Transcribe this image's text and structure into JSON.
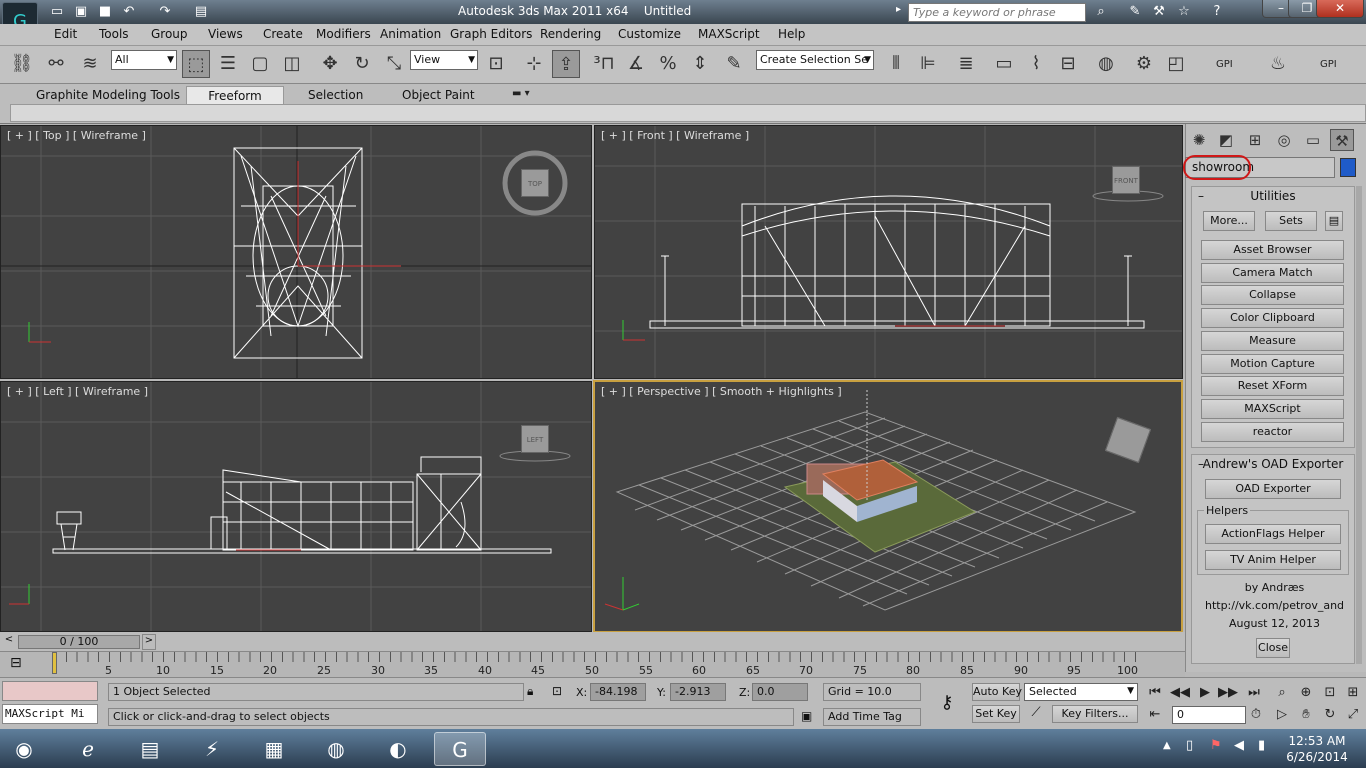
{
  "title": {
    "app": "Autodesk 3ds Max  2011 x64",
    "doc": "Untitled",
    "search_placeholder": "Type a keyword or phrase"
  },
  "menu": [
    "Edit",
    "Tools",
    "Group",
    "Views",
    "Create",
    "Modifiers",
    "Animation",
    "Graph Editors",
    "Rendering",
    "Customize",
    "MAXScript",
    "Help"
  ],
  "toolbar": {
    "filter": "All",
    "ref_coord": "View",
    "selection_set": "Create Selection Se",
    "gpi1": "GPI",
    "gpi2": "GPI"
  },
  "ribbon": {
    "tabs": [
      "Graphite Modeling Tools",
      "Freeform",
      "Selection",
      "Object Paint"
    ]
  },
  "viewports": {
    "top": "[ + ] [ Top ] [ Wireframe ]",
    "front": "[ + ] [ Front ] [ Wireframe ]",
    "left": "[ + ] [ Left ] [ Wireframe ]",
    "persp": "[ + ] [ Perspective ] [ Smooth + Highlights ]",
    "cube_top": "TOP",
    "cube_front": "FRONT",
    "cube_left": "LEFT"
  },
  "panel": {
    "object_name": "showroom",
    "colors": {
      "object": "#1f5bc8",
      "highlight": "#d01818"
    },
    "utilities_title": "Utilities",
    "more": "More...",
    "sets": "Sets",
    "utilities": [
      "Asset Browser",
      "Camera Match",
      "Collapse",
      "Color Clipboard",
      "Measure",
      "Motion Capture",
      "Reset XForm",
      "MAXScript",
      "reactor"
    ],
    "oad_title": "Andrew's OAD Exporter",
    "oad_button": "OAD Exporter",
    "helpers_label": "Helpers",
    "helpers": [
      "ActionFlags Helper",
      "TV Anim Helper"
    ],
    "credit1": "by Andræs",
    "credit2": "http://vk.com/petrov_and",
    "credit3": "August 12, 2013",
    "close": "Close"
  },
  "timeline": {
    "frame": "0 / 100",
    "ticks": [
      "0",
      "5",
      "10",
      "15",
      "20",
      "25",
      "30",
      "35",
      "40",
      "45",
      "50",
      "55",
      "60",
      "65",
      "70",
      "75",
      "80",
      "85",
      "90",
      "95",
      "100"
    ]
  },
  "status": {
    "maxscript": "MAXScript Mi",
    "selected": "1 Object Selected",
    "prompt": "Click or click-and-drag to select objects",
    "x_label": "X:",
    "x": "-84.198",
    "y_label": "Y:",
    "y": "-2.913",
    "z_label": "Z:",
    "z": "0.0",
    "grid": "Grid = 10.0",
    "add_time_tag": "Add Time Tag",
    "auto_key": "Auto Key",
    "set_key": "Set Key",
    "key_mode": "Selected",
    "key_filters": "Key Filters...",
    "frame_field": "0"
  },
  "taskbar": {
    "time": "12:53 AM",
    "date": "6/26/2014"
  }
}
